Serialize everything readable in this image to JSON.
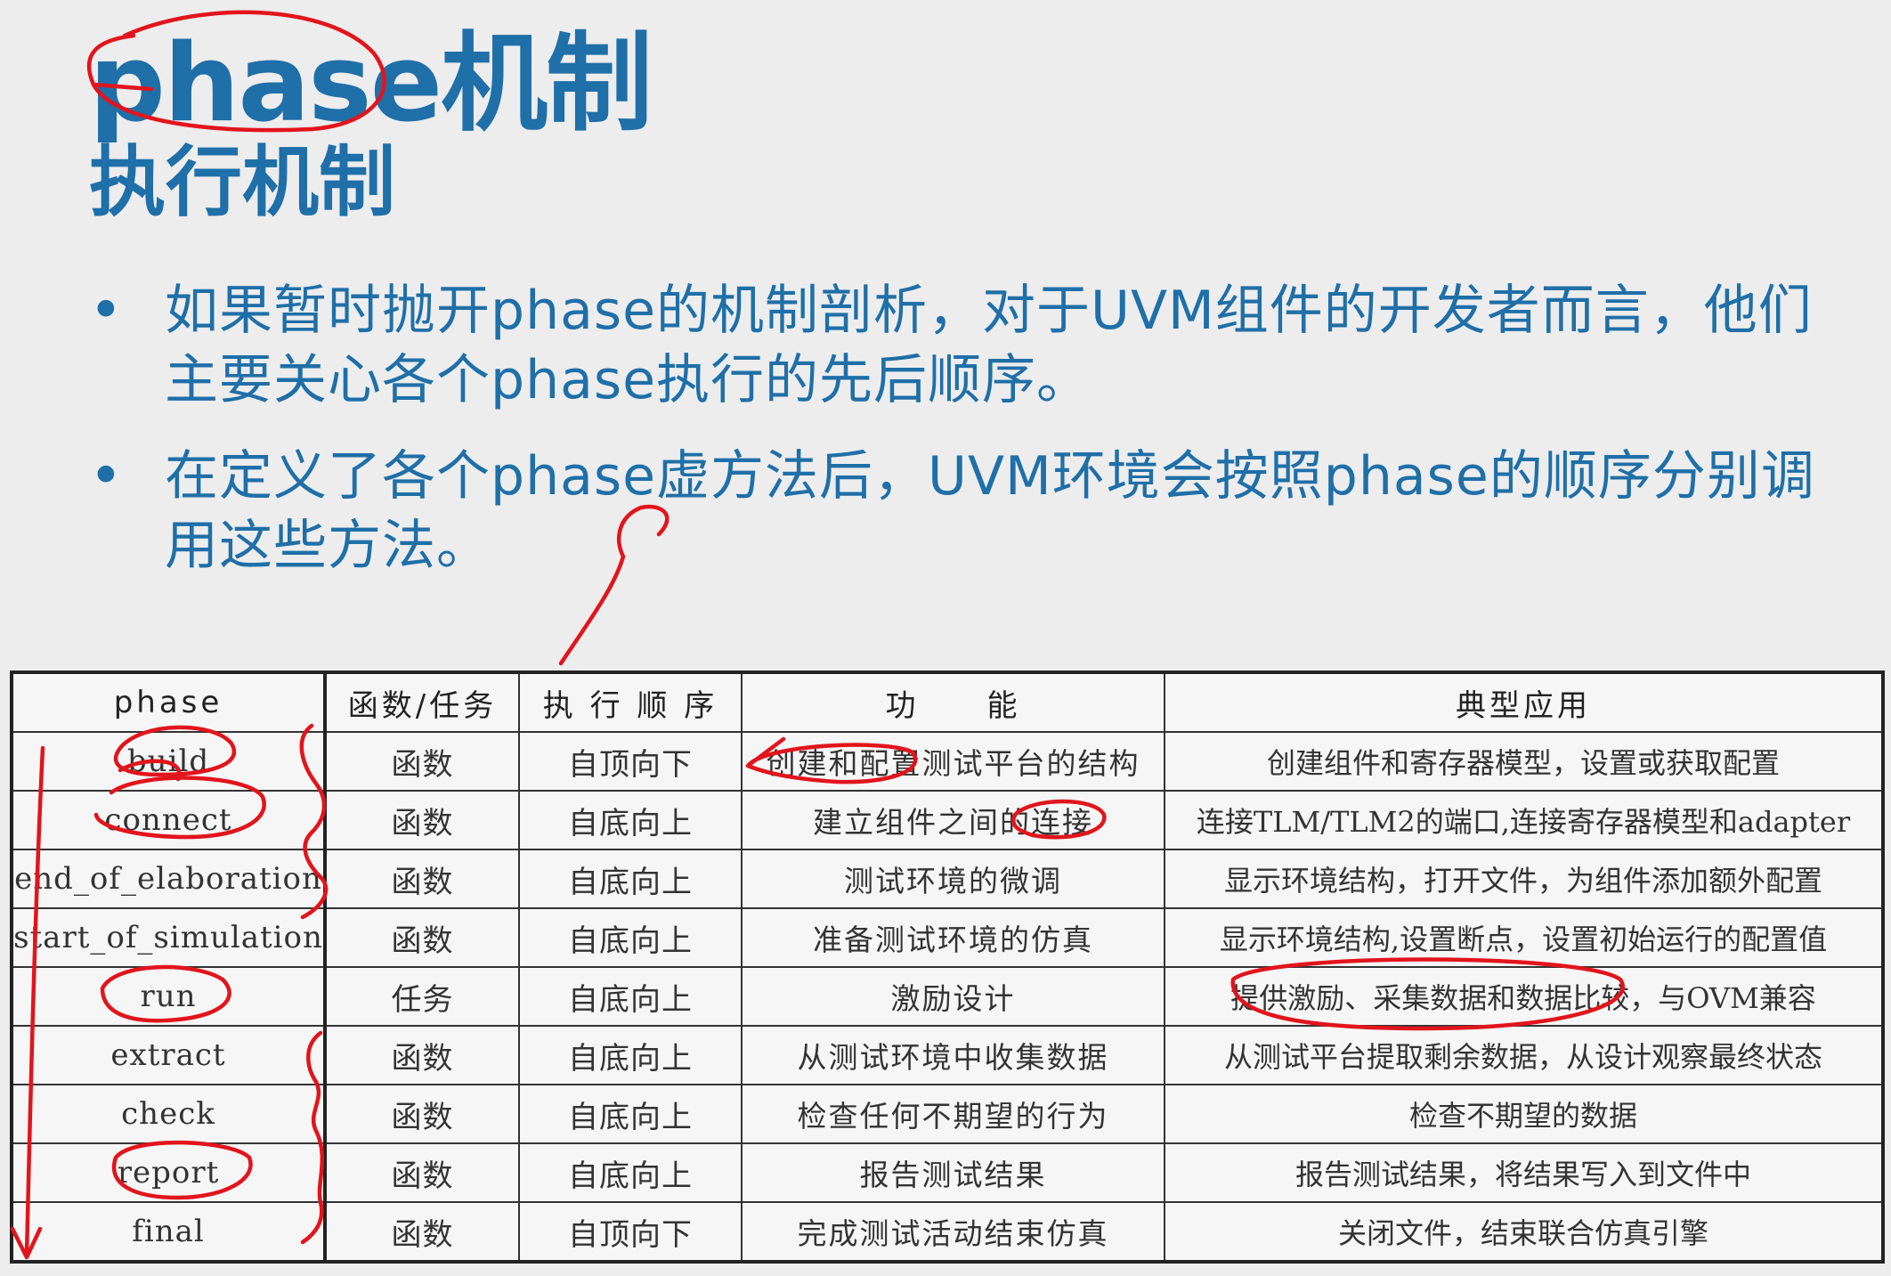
{
  "title": "phase机制",
  "subtitle": "执行机制",
  "bullets": [
    {
      "text": "如果暂时抛开phase的机制剖析，对于UVM组件的开发者而言，他们主要关心各个phase执行的先后顺序。"
    },
    {
      "text": "在定义了各个phase虚方法后，UVM环境会按照phase的顺序分别调用这些方法。"
    }
  ],
  "table": {
    "headers": {
      "phase": "phase",
      "type": "函数/任务",
      "order": "执 行 顺 序",
      "function": "功　　能",
      "usage": "典型应用"
    },
    "rows": [
      {
        "phase": "build",
        "type": "函数",
        "order": "自顶向下",
        "function": "创建和配置测试平台的结构",
        "usage": "创建组件和寄存器模型，设置或获取配置"
      },
      {
        "phase": "connect",
        "type": "函数",
        "order": "自底向上",
        "function": "建立组件之间的连接",
        "usage": "连接TLM/TLM2的端口,连接寄存器模型和adapter"
      },
      {
        "phase": "end_of_elaboration",
        "type": "函数",
        "order": "自底向上",
        "function": "测试环境的微调",
        "usage": "显示环境结构，打开文件，为组件添加额外配置"
      },
      {
        "phase": "start_of_simulation",
        "type": "函数",
        "order": "自底向上",
        "function": "准备测试环境的仿真",
        "usage": "显示环境结构,设置断点，设置初始运行的配置值"
      },
      {
        "phase": "run",
        "type": "任务",
        "order": "自底向上",
        "function": "激励设计",
        "usage": "提供激励、采集数据和数据比较，与OVM兼容"
      },
      {
        "phase": "extract",
        "type": "函数",
        "order": "自底向上",
        "function": "从测试环境中收集数据",
        "usage": "从测试平台提取剩余数据，从设计观察最终状态"
      },
      {
        "phase": "check",
        "type": "函数",
        "order": "自底向上",
        "function": "检查任何不期望的行为",
        "usage": "检查不期望的数据"
      },
      {
        "phase": "report",
        "type": "函数",
        "order": "自底向上",
        "function": "报告测试结果",
        "usage": "报告测试结果，将结果写入到文件中"
      },
      {
        "phase": "final",
        "type": "函数",
        "order": "自顶向下",
        "function": "完成测试活动结束仿真",
        "usage": "关闭文件，结束联合仿真引擎"
      }
    ]
  },
  "annotation": {
    "ink_color": "#e2141c"
  }
}
